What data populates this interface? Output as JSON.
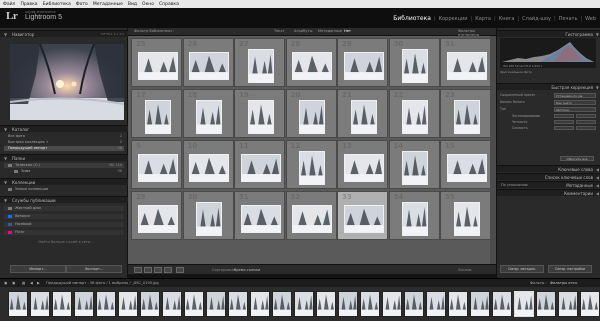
{
  "menu": [
    "Файл",
    "Правка",
    "Библиотека",
    "Фото",
    "Метаданные",
    "Вид",
    "Окно",
    "Справка"
  ],
  "identity": {
    "logo": "Lr",
    "adobe": "ADOBE PHOTOSHOP",
    "product": "Lightroom 5"
  },
  "modules": [
    {
      "label": "Библиотека",
      "active": true
    },
    {
      "label": "Коррекции",
      "active": false
    },
    {
      "label": "Карта",
      "active": false
    },
    {
      "label": "Книга",
      "active": false
    },
    {
      "label": "Слайд-шоу",
      "active": false
    },
    {
      "label": "Печать",
      "active": false
    },
    {
      "label": "Web",
      "active": false
    }
  ],
  "left": {
    "navigator": {
      "title": "Навигатор",
      "zoom": "FIT  FILL  1:1  3:1"
    },
    "catalog": {
      "title": "Каталог",
      "items": [
        {
          "label": "Все фото",
          "count": "2"
        },
        {
          "label": "Быстрая коллекция +",
          "count": "0"
        },
        {
          "label": "Предыдущий импорт",
          "count": "36",
          "selected": true
        }
      ]
    },
    "folders": {
      "title": "Папки",
      "volume": {
        "label": "Телескоп (C:)",
        "count": "36/ 120"
      },
      "items": [
        {
          "label": "Зима",
          "count": "36"
        }
      ]
    },
    "collections": {
      "title": "Коллекции",
      "items": [
        {
          "label": "Умные коллекции"
        }
      ]
    },
    "publish": {
      "title": "Службы публикации",
      "items": [
        {
          "label": "Жесткий диск"
        },
        {
          "label": "Behance"
        },
        {
          "label": "Facebook"
        },
        {
          "label": "Flickr"
        }
      ],
      "find_more": "Найти больше служб в сети..."
    },
    "import_btn": "Импорт...",
    "export_btn": "Экспорт..."
  },
  "grid": {
    "filter_label": "Фильтр библиотеки :",
    "filters": [
      {
        "label": "Текст",
        "active": false
      },
      {
        "label": "Атрибуты",
        "active": false
      },
      {
        "label": "Метаданные",
        "active": false
      },
      {
        "label": "Нет",
        "active": true
      }
    ],
    "filter_preset": "Фильтры отключены",
    "cells": [
      {
        "num": "25"
      },
      {
        "num": "26"
      },
      {
        "num": "27"
      },
      {
        "num": "28"
      },
      {
        "num": "29"
      },
      {
        "num": "30"
      },
      {
        "num": "31"
      },
      {
        "num": "17"
      },
      {
        "num": "18"
      },
      {
        "num": "19"
      },
      {
        "num": "20"
      },
      {
        "num": "21"
      },
      {
        "num": "22"
      },
      {
        "num": "23"
      },
      {
        "num": "9"
      },
      {
        "num": "10"
      },
      {
        "num": "11"
      },
      {
        "num": "12"
      },
      {
        "num": "13"
      },
      {
        "num": "14"
      },
      {
        "num": "15"
      },
      {
        "num": "29"
      },
      {
        "num": "30"
      },
      {
        "num": "31"
      },
      {
        "num": "32"
      },
      {
        "num": "33",
        "selected": true
      },
      {
        "num": "34"
      },
      {
        "num": "35"
      }
    ],
    "sort_label": "Сортировка:",
    "sort_value": "Время съемки",
    "thumbs_label": "Эскизы"
  },
  "right": {
    "histogram": {
      "title": "Гистограмма",
      "info": "ISO 200  50 мм  f/5,6  1/250 с",
      "original": "Оригинальное фото"
    },
    "quick_develop": {
      "title": "Быстрая коррекция",
      "rows": [
        {
          "label": "Сохраненный пресет",
          "value": "Установки по ум."
        },
        {
          "label": "Баланс белого",
          "value": "Как снято"
        },
        {
          "label": "Тон",
          "value": "Автотон"
        },
        {
          "label": "Экспонирование",
          "value": ""
        },
        {
          "label": "Четкость",
          "value": ""
        },
        {
          "label": "Сочность",
          "value": ""
        }
      ],
      "reset": "Сбросить все"
    },
    "keywording": "Ключевые слова",
    "keyword_list": "Список ключевых слов",
    "metadata_preset": "По умолчанию",
    "metadata": "Метаданные",
    "comments": "Комментарии",
    "sync": "Синхр. метадан.",
    "sync_settings": "Синхр. настройки"
  },
  "filmstrip": {
    "info": "Предыдущий импорт : 36 фото / 1 выбрано / _DSC_0190.jpg",
    "filter": "Фильтр :",
    "filter_value": "Фильтры откл.",
    "selected_index": 23
  },
  "colors": {
    "app_bg": "#141414",
    "panel_bg": "#2a2a2a",
    "grid_bg": "#5a5a5a",
    "cell_bg": "#7b7b7b",
    "cell_selected": "#b0b0b0",
    "highlight": "#ffffff"
  }
}
